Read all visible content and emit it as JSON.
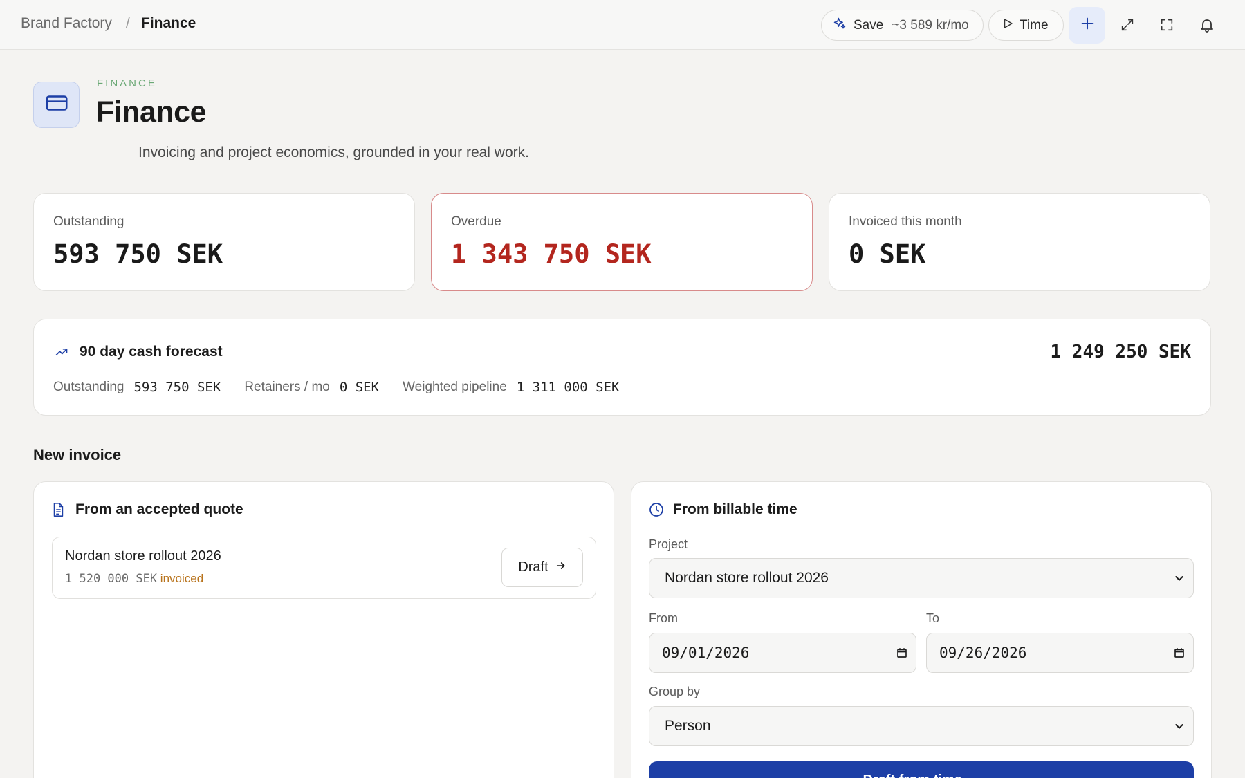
{
  "colors": {
    "accent": "#1d3fa6",
    "overdue": "#b3261e",
    "eyebrow": "#6aa875",
    "invoiced": "#b8731c"
  },
  "breadcrumb": {
    "root": "Brand Factory",
    "separator": "/",
    "current": "Finance"
  },
  "toolbar": {
    "save_label": "Save",
    "save_rate": "~3 589 kr/mo",
    "time_label": "Time",
    "icons": [
      "sparkle-icon",
      "play-icon",
      "plus-icon",
      "expand-icon",
      "fullscreen-icon",
      "bell-icon"
    ]
  },
  "header": {
    "eyebrow": "FINANCE",
    "title": "Finance",
    "subtitle": "Invoicing and project economics, grounded in your real work.",
    "icon": "credit-card-icon"
  },
  "stats": [
    {
      "label": "Outstanding",
      "value": "593 750 SEK"
    },
    {
      "label": "Overdue",
      "value": "1 343 750 SEK"
    },
    {
      "label": "Invoiced this month",
      "value": "0 SEK"
    }
  ],
  "forecast": {
    "title": "90 day cash forecast",
    "total": "1 249 250 SEK",
    "items": [
      {
        "label": "Outstanding",
        "value": "593 750 SEK"
      },
      {
        "label": "Retainers / mo",
        "value": "0 SEK"
      },
      {
        "label": "Weighted pipeline",
        "value": "1 311 000 SEK"
      }
    ]
  },
  "new_invoice": {
    "section_title": "New invoice",
    "from_quote": {
      "title": "From an accepted quote",
      "quote_name": "Nordan store rollout 2026",
      "quote_amount": "1 520 000 SEK",
      "quote_status": "invoiced",
      "draft_label": "Draft"
    },
    "from_time": {
      "title": "From billable time",
      "project_label": "Project",
      "project_value": "Nordan store rollout 2026",
      "from_label": "From",
      "from_value": "09/01/2026",
      "to_label": "To",
      "to_value": "09/26/2026",
      "group_label": "Group by",
      "group_value": "Person",
      "submit_label": "Draft from time →"
    }
  }
}
